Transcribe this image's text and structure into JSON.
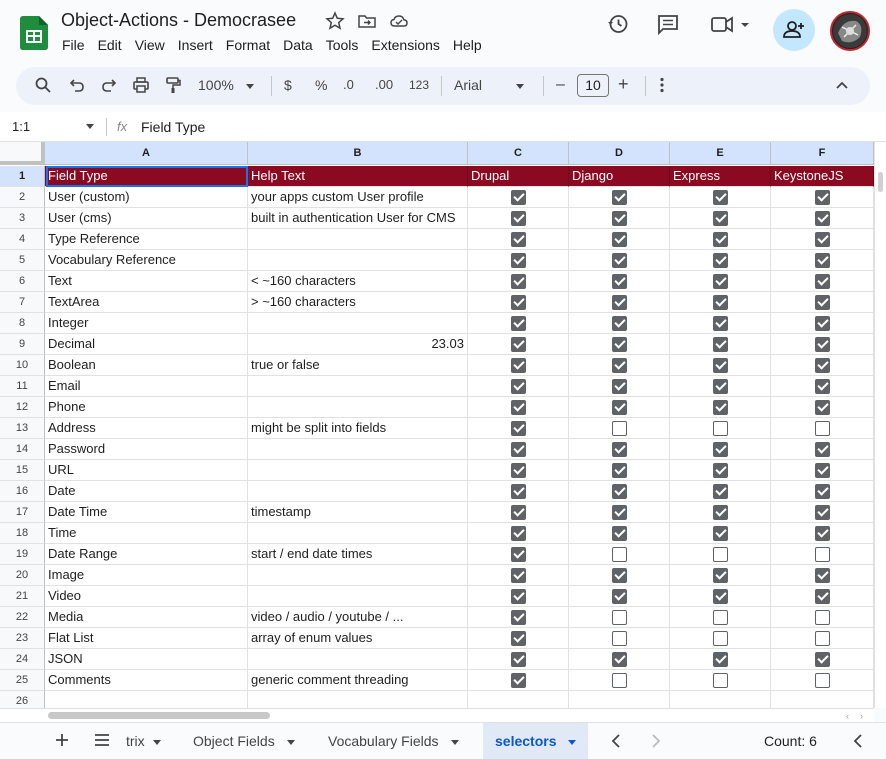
{
  "app": {
    "title": "Object-Actions - Democrasee",
    "menu": [
      "File",
      "Edit",
      "View",
      "Insert",
      "Format",
      "Data",
      "Tools",
      "Extensions",
      "Help"
    ]
  },
  "toolbar": {
    "zoom": "100%",
    "currency": "$",
    "percent": "%",
    "dec_decrease": ".0",
    "dec_increase": ".00",
    "format_123": "123",
    "font": "Arial",
    "font_size": "10",
    "minus": "–",
    "plus": "+"
  },
  "formula_bar": {
    "name_box": "1:1",
    "fx": "fx",
    "value": "Field Type"
  },
  "columns": [
    {
      "letter": "A"
    },
    {
      "letter": "B"
    },
    {
      "letter": "C"
    },
    {
      "letter": "D"
    },
    {
      "letter": "E"
    },
    {
      "letter": "F"
    }
  ],
  "header_row": [
    "Field Type",
    "Help Text",
    "Drupal",
    "Django",
    "Express",
    "KeystoneJS"
  ],
  "rows": [
    {
      "n": "2",
      "a": "User (custom)",
      "b": "your apps custom User profile",
      "c": [
        true,
        true,
        true,
        true
      ]
    },
    {
      "n": "3",
      "a": "User (cms)",
      "b": "built in authentication User for CMS",
      "c": [
        true,
        true,
        true,
        true
      ]
    },
    {
      "n": "4",
      "a": "Type Reference",
      "b": "",
      "c": [
        true,
        true,
        true,
        true
      ]
    },
    {
      "n": "5",
      "a": "Vocabulary Reference",
      "b": "",
      "c": [
        true,
        true,
        true,
        true
      ]
    },
    {
      "n": "6",
      "a": "Text",
      "b": "< ~160 characters",
      "c": [
        true,
        true,
        true,
        true
      ]
    },
    {
      "n": "7",
      "a": "TextArea",
      "b": "> ~160 characters",
      "c": [
        true,
        true,
        true,
        true
      ]
    },
    {
      "n": "8",
      "a": "Integer",
      "b": "",
      "c": [
        true,
        true,
        true,
        true
      ]
    },
    {
      "n": "9",
      "a": "Decimal",
      "b": "23.03",
      "num": true,
      "c": [
        true,
        true,
        true,
        true
      ]
    },
    {
      "n": "10",
      "a": "Boolean",
      "b": "true or false",
      "c": [
        true,
        true,
        true,
        true
      ]
    },
    {
      "n": "11",
      "a": "Email",
      "b": "",
      "c": [
        true,
        true,
        true,
        true
      ]
    },
    {
      "n": "12",
      "a": "Phone",
      "b": "",
      "c": [
        true,
        true,
        true,
        true
      ]
    },
    {
      "n": "13",
      "a": "Address",
      "b": "might be split into fields",
      "c": [
        true,
        false,
        false,
        false
      ]
    },
    {
      "n": "14",
      "a": "Password",
      "b": "",
      "c": [
        true,
        true,
        true,
        true
      ]
    },
    {
      "n": "15",
      "a": "URL",
      "b": "",
      "c": [
        true,
        true,
        true,
        true
      ]
    },
    {
      "n": "16",
      "a": "Date",
      "b": "",
      "c": [
        true,
        true,
        true,
        true
      ]
    },
    {
      "n": "17",
      "a": "Date Time",
      "b": "timestamp",
      "c": [
        true,
        true,
        true,
        true
      ]
    },
    {
      "n": "18",
      "a": "Time",
      "b": "",
      "c": [
        true,
        true,
        true,
        true
      ]
    },
    {
      "n": "19",
      "a": "Date Range",
      "b": "start / end date times",
      "c": [
        true,
        false,
        false,
        false
      ]
    },
    {
      "n": "20",
      "a": "Image",
      "b": "",
      "c": [
        true,
        true,
        true,
        true
      ]
    },
    {
      "n": "21",
      "a": "Video",
      "b": "",
      "c": [
        true,
        true,
        true,
        true
      ]
    },
    {
      "n": "22",
      "a": "Media",
      "b": "video / audio / youtube / ...",
      "c": [
        true,
        false,
        false,
        false
      ]
    },
    {
      "n": "23",
      "a": "Flat List",
      "b": "array of enum values",
      "c": [
        true,
        false,
        false,
        false
      ]
    },
    {
      "n": "24",
      "a": "JSON",
      "b": "",
      "c": [
        true,
        true,
        true,
        true
      ]
    },
    {
      "n": "25",
      "a": "Comments",
      "b": "generic comment threading",
      "c": [
        true,
        false,
        false,
        false
      ]
    },
    {
      "n": "26",
      "a": "",
      "b": "",
      "c": []
    }
  ],
  "sheet_tabs": {
    "partial": "trix",
    "tab1": "Object Fields",
    "tab2": "Vocabulary Fields",
    "active": "selectors",
    "count": "Count: 6"
  },
  "colors": {
    "header_fill": "#8b0a22",
    "accent": "#0b57d0"
  }
}
